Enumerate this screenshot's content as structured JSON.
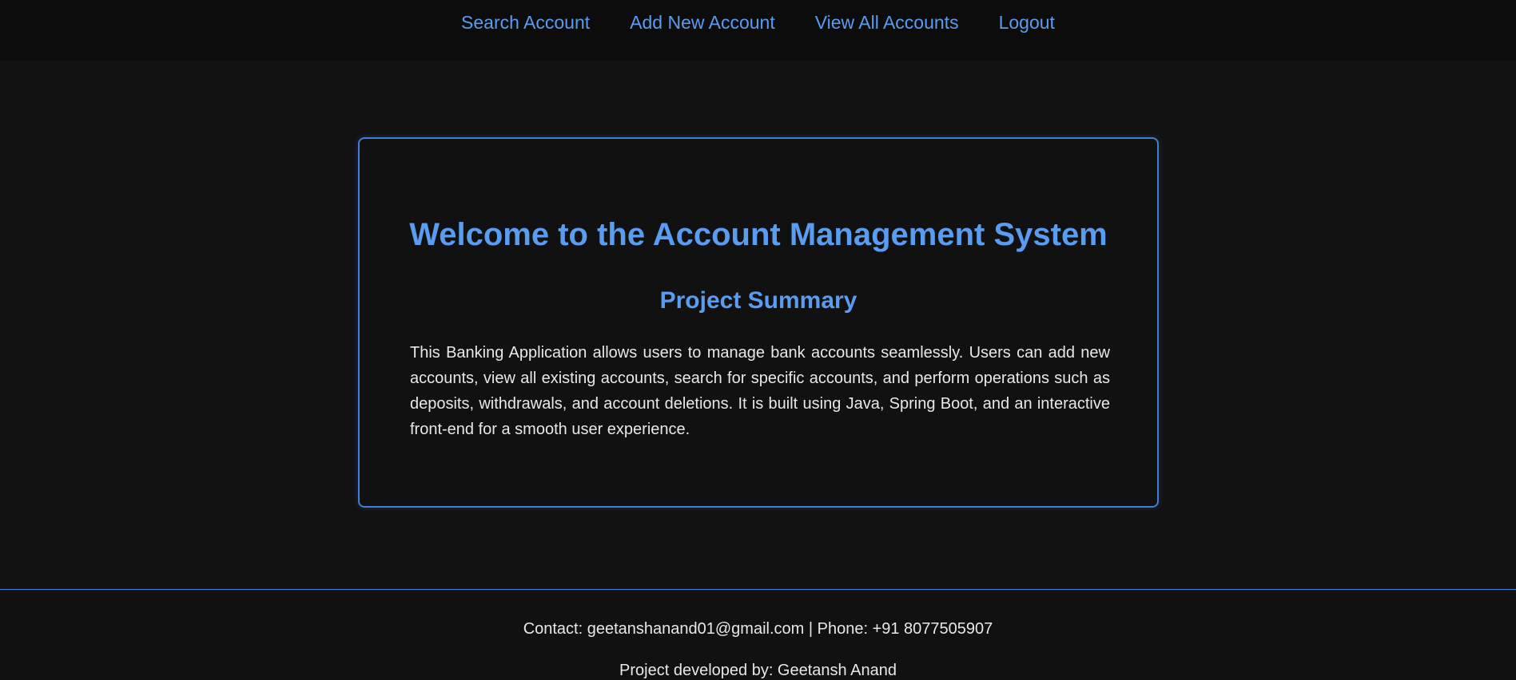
{
  "nav": {
    "items": [
      {
        "label": "Search Account"
      },
      {
        "label": "Add New Account"
      },
      {
        "label": "View All Accounts"
      },
      {
        "label": "Logout"
      }
    ]
  },
  "main": {
    "title": "Welcome to the Account Management System",
    "subtitle": "Project Summary",
    "summary": "This Banking Application allows users to manage bank accounts seamlessly. Users can add new accounts, view all existing accounts, search for specific accounts, and perform operations such as deposits, withdrawals, and account deletions. It is built using Java, Spring Boot, and an interactive front-end for a smooth user experience."
  },
  "footer": {
    "contact": "Contact: geetanshanand01@gmail.com | Phone: +91 8077505907",
    "credit": "Project developed by: Geetansh Anand"
  },
  "colors": {
    "background": "#121212",
    "navbar": "#0c0c0c",
    "accent": "#5a9cf0",
    "border": "#3f7fd6",
    "text": "#e8e8e8"
  }
}
